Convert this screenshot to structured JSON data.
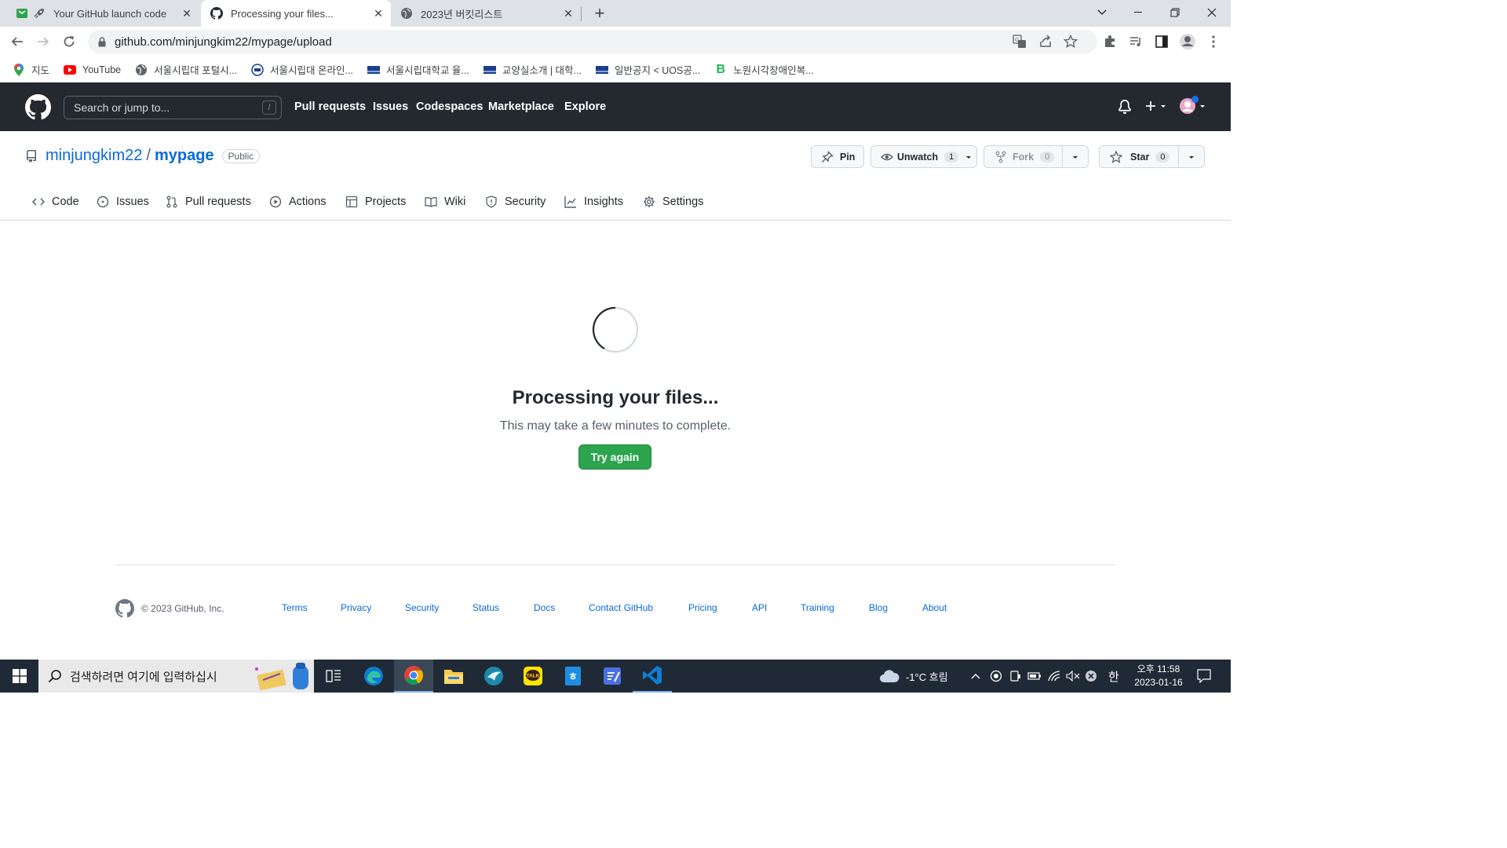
{
  "browser": {
    "tabs": [
      {
        "title": "Your GitHub launch code",
        "icon": "rocket-icon",
        "active": false
      },
      {
        "title": "Processing your files...",
        "icon": "github-icon",
        "active": true
      },
      {
        "title": "2023년 버킷리스트",
        "icon": "globe-icon",
        "active": false
      }
    ],
    "url": "github.com/minjungkim22/mypage/upload",
    "bookmarks": [
      {
        "label": "지도",
        "icon": "maps-pin-icon"
      },
      {
        "label": "YouTube",
        "icon": "youtube-icon"
      },
      {
        "label": "서울시립대 포털시...",
        "icon": "globe-icon"
      },
      {
        "label": "서울시립대 온라인...",
        "icon": "uos-online-icon"
      },
      {
        "label": "서울시립대학교 율...",
        "icon": "uos-flag-icon"
      },
      {
        "label": "교양실소개 | 대학...",
        "icon": "uos-flag-icon"
      },
      {
        "label": "일반공지 < UOS공...",
        "icon": "uos-flag-icon"
      },
      {
        "label": "노원시각장애인복...",
        "icon": "b-letter-icon"
      }
    ]
  },
  "github_header": {
    "search_placeholder": "Search or jump to...",
    "search_shortcut": "/",
    "nav": [
      "Pull requests",
      "Issues",
      "Codespaces",
      "Marketplace",
      "Explore"
    ]
  },
  "repo": {
    "owner": "minjungkim22",
    "separator": "/",
    "name": "mypage",
    "visibility": "Public",
    "actions": {
      "pin": "Pin",
      "unwatch": "Unwatch",
      "unwatch_count": "1",
      "fork": "Fork",
      "fork_count": "0",
      "star": "Star",
      "star_count": "0"
    },
    "nav": [
      {
        "label": "Code",
        "icon": "code-icon"
      },
      {
        "label": "Issues",
        "icon": "issue-circle-icon"
      },
      {
        "label": "Pull requests",
        "icon": "pull-request-icon"
      },
      {
        "label": "Actions",
        "icon": "play-circle-icon"
      },
      {
        "label": "Projects",
        "icon": "table-icon"
      },
      {
        "label": "Wiki",
        "icon": "book-icon"
      },
      {
        "label": "Security",
        "icon": "shield-icon"
      },
      {
        "label": "Insights",
        "icon": "graph-icon"
      },
      {
        "label": "Settings",
        "icon": "gear-icon"
      }
    ]
  },
  "main": {
    "title": "Processing your files...",
    "subtitle": "This may take a few minutes to complete.",
    "button": "Try again"
  },
  "footer": {
    "copyright": "© 2023 GitHub, Inc.",
    "links": [
      "Terms",
      "Privacy",
      "Security",
      "Status",
      "Docs",
      "Contact GitHub",
      "Pricing",
      "API",
      "Training",
      "Blog",
      "About"
    ]
  },
  "taskbar": {
    "search_placeholder": "검색하려면 여기에 입력하십시",
    "weather": "-1°C 흐림",
    "ime": "한",
    "time": "오후 11:58",
    "date": "2023-01-16"
  },
  "colors": {
    "github_header_bg": "#24292f",
    "link_blue": "#0969da",
    "button_green": "#2da44e",
    "taskbar_bg": "#1f2a36"
  }
}
